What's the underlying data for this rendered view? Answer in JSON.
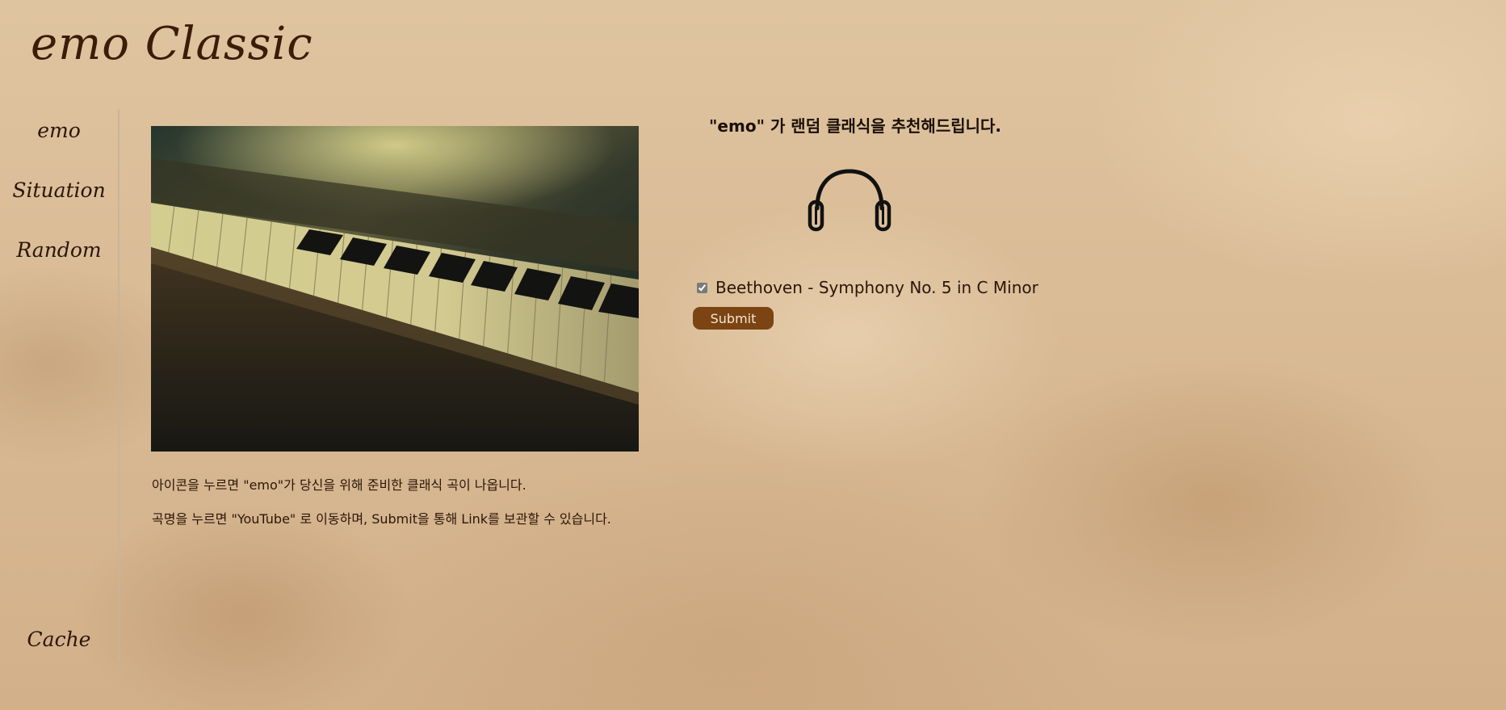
{
  "site": {
    "logo": "emo Classic"
  },
  "nav": {
    "items": [
      {
        "label": "emo"
      },
      {
        "label": "Situation"
      },
      {
        "label": "Random"
      }
    ],
    "cache_label": "Cache"
  },
  "hero": {
    "image_icon": "piano-keys-image"
  },
  "description": {
    "line1": "아이콘을 누르면 \"emo\"가 당신을 위해 준비한 클래식 곡이 나옵니다.",
    "line2": "곡명을 누르면 \"YouTube\" 로 이동하며, Submit을 통해 Link를 보관할 수 있습니다."
  },
  "recommend": {
    "title": "\"emo\" 가 랜덤 클래식을 추천해드립니다.",
    "icon": "headphones-icon",
    "song": {
      "title": "Beethoven - Symphony No. 5 in C Minor",
      "checked": true
    },
    "submit_label": "Submit"
  },
  "colors": {
    "background": "#dcbf9a",
    "text": "#2b1608",
    "button": "#7b4412",
    "button_text": "#f4e6d3",
    "divider": "#c9b49b"
  }
}
